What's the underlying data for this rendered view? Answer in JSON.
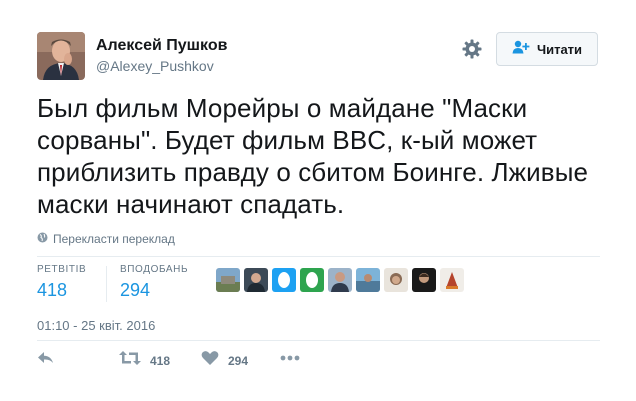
{
  "header": {
    "display_name": "Алексей Пушков",
    "handle": "@Alexey_Pushkov",
    "follow_label": "Читати"
  },
  "tweet": {
    "text": "Был фильм Морейры о майдане \"Маски сорваны\". Будет фильм BBC, к-ый может приблизить правду о сбитом Боинге. Лживые маски начинают спадать.",
    "translate_label": "Перекласти переклад"
  },
  "stats": {
    "retweets_label": "РЕТВІТІВ",
    "retweets_value": "418",
    "likes_label": "ВПОДОБАНЬ",
    "likes_value": "294"
  },
  "likers": [
    "avatar-1",
    "avatar-2",
    "avatar-3",
    "avatar-4",
    "avatar-5",
    "avatar-6",
    "avatar-7",
    "avatar-8",
    "avatar-9"
  ],
  "timestamp": "01:10 - 25 квіт. 2016",
  "actions": {
    "reply_icon": "reply-icon",
    "retweet_count": "418",
    "like_count": "294",
    "more_icon": "more-icon"
  },
  "colors": {
    "accent": "#1b95e0",
    "muted": "#657786",
    "text": "#14171a",
    "divider": "#e6ecf0"
  }
}
